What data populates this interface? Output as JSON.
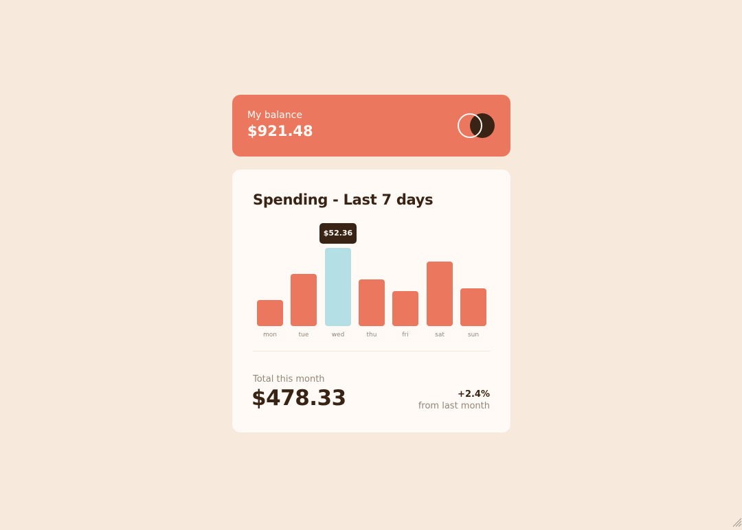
{
  "balance": {
    "label": "My balance",
    "amount": "$921.48",
    "logo_icon": "brand-circles-icon"
  },
  "spending": {
    "title": "Spending - Last 7 days",
    "tooltip": "$52.36",
    "total_label": "Total this month",
    "total_amount": "$478.33",
    "change_value": "+2.4%",
    "change_caption": "from last month"
  },
  "colors": {
    "page_bg": "#f7e9dc",
    "bar": "#ec775f",
    "bar_active": "#b4e0e5",
    "dark": "#382314",
    "card": "#fffaf5"
  },
  "chart_data": {
    "type": "bar",
    "categories": [
      "mon",
      "tue",
      "wed",
      "thu",
      "fri",
      "sat",
      "sun"
    ],
    "values": [
      17.45,
      34.91,
      52.36,
      31.07,
      23.39,
      43.28,
      25.48
    ],
    "highlighted": "wed",
    "ylim": [
      0,
      52.36
    ]
  }
}
